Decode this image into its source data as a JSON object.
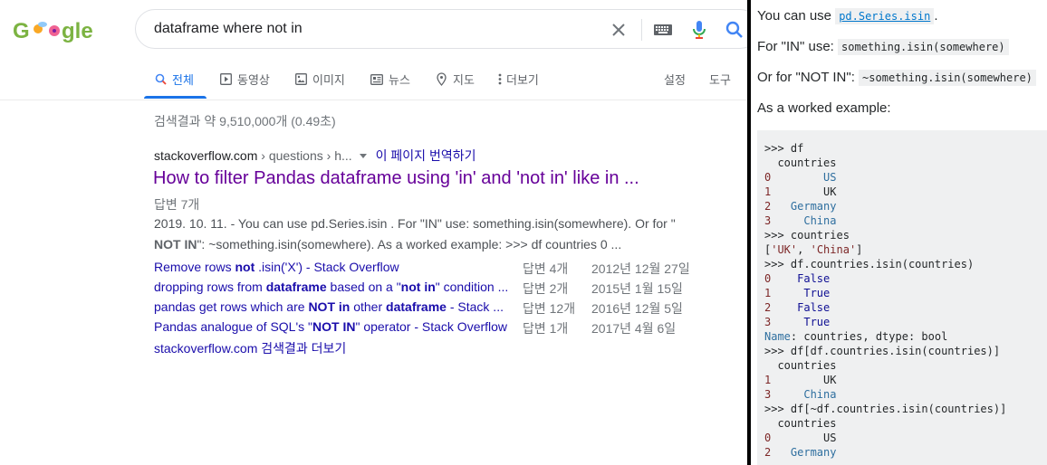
{
  "search": {
    "query": "dataframe where not in"
  },
  "tabs": [
    {
      "label": "전체",
      "icon": "search-icon",
      "active": true
    },
    {
      "label": "동영상",
      "icon": "video-icon"
    },
    {
      "label": "이미지",
      "icon": "image-icon"
    },
    {
      "label": "뉴스",
      "icon": "news-icon"
    },
    {
      "label": "지도",
      "icon": "map-pin-icon"
    },
    {
      "label": "더보기",
      "icon": "more-vert-icon"
    }
  ],
  "tools": {
    "settings": "설정",
    "tools": "도구"
  },
  "stats": "검색결과 약 9,510,000개 (0.49초)",
  "result": {
    "site": "stackoverflow.com",
    "path": " › questions › h...",
    "translate": "이 페이지 번역하기",
    "title": "How to filter Pandas dataframe using 'in' and 'not in' like in ...",
    "answers": "답변 7개",
    "snippet_line1": "2019. 10. 11. - You can use pd.Series.isin . For \"IN\" use: something.isin(somewhere). Or for \"",
    "snippet_bold": "NOT IN",
    "snippet_line2": "\": ~something.isin(somewhere). As a worked example: >>> df countries 0 ...",
    "sublinks": [
      {
        "pre": "Remove rows ",
        "b": "not",
        "post": " .isin('X') - Stack Overflow",
        "answers": "답변 4개",
        "date": "2012년 12월 27일"
      },
      {
        "pre": "dropping rows from ",
        "b": "dataframe",
        "mid": " based on a \"",
        "b2": "not in",
        "post": "\" condition ...",
        "answers": "답변 2개",
        "date": "2015년 1월 15일"
      },
      {
        "pre": "pandas get rows which are ",
        "b": "NOT in",
        "mid": " other ",
        "b2": "dataframe",
        "post": " - Stack ...",
        "answers": "답변 12개",
        "date": "2016년 12월 5일"
      },
      {
        "pre": "Pandas analogue of SQL's \"",
        "b": "NOT IN",
        "post": "\" operator - Stack Overflow",
        "answers": "답변 1개",
        "date": "2017년 4월 6일"
      }
    ],
    "more": "stackoverflow.com 검색결과 더보기"
  },
  "answer": {
    "p1_pre": "You can use ",
    "p1_code": "pd.Series.isin",
    "p1_post": ".",
    "p2_pre": "For \"IN\" use: ",
    "p2_code": "something.isin(somewhere)",
    "p3_pre": "Or for \"NOT IN\": ",
    "p3_code": "~something.isin(somewhere)",
    "p4": "As a worked example:",
    "code": {
      "l1": ">>> df",
      "l2": "  countries",
      "l3n": "0",
      "l3v": "        US",
      "l4n": "1",
      "l4v": "        UK",
      "l5n": "2",
      "l5v": "   Germany",
      "l6n": "3",
      "l6v": "     China",
      "l7": ">>> countries",
      "l8a": "[",
      "l8b": "'UK'",
      "l8c": ", ",
      "l8d": "'China'",
      "l8e": "]",
      "l9": ">>> df.countries.isin(countries)",
      "l10n": "0",
      "l10v": "    False",
      "l11n": "1",
      "l11v": "     True",
      "l12n": "2",
      "l12v": "    False",
      "l13n": "3",
      "l13v": "     True",
      "l14a": "Name",
      "l14b": ": countries, dtype: bool",
      "l15": ">>> df[df.countries.isin(countries)]",
      "l16": "  countries",
      "l17n": "1",
      "l17v": "        UK",
      "l18n": "3",
      "l18v": "     China",
      "l19": ">>> df[~df.countries.isin(countries)]",
      "l20": "  countries",
      "l21n": "0",
      "l21v": "        US",
      "l22n": "2",
      "l22v": "   Germany"
    }
  }
}
